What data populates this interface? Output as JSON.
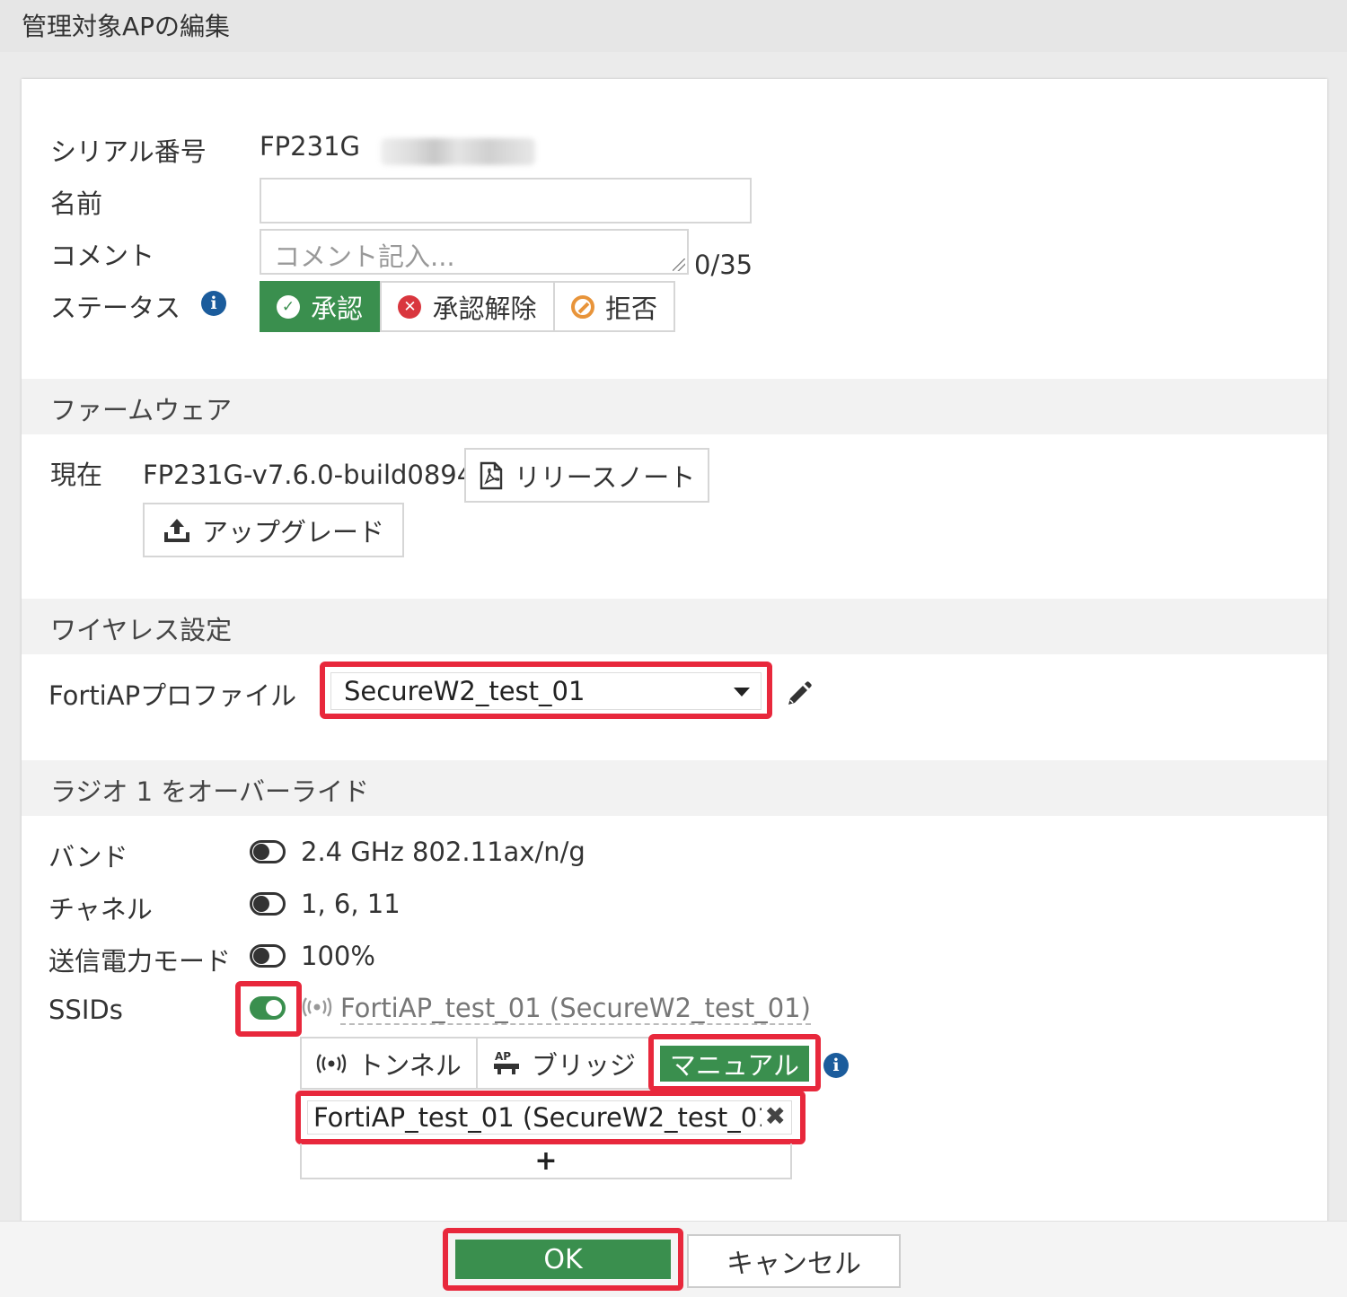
{
  "window": {
    "title": "管理対象APの編集"
  },
  "general": {
    "serial_label": "シリアル番号",
    "serial_value": "FP231G",
    "name_label": "名前",
    "name_value": "",
    "comment_label": "コメント",
    "comment_placeholder": "コメント記入...",
    "comment_counter": "0/35",
    "status_label": "ステータス",
    "status_options": [
      "承認",
      "承認解除",
      "拒否"
    ],
    "status_selected": "承認"
  },
  "firmware": {
    "section_title": "ファームウェア",
    "current_label": "現在",
    "current_value": "FP231G-v7.6.0-build0894",
    "release_notes_label": "リリースノート",
    "upgrade_label": "アップグレード"
  },
  "wireless": {
    "section_title": "ワイヤレス設定",
    "profile_label": "FortiAPプロファイル",
    "profile_value": "SecureW2_test_01"
  },
  "radio1": {
    "section_title": "ラジオ 1 をオーバーライド",
    "band_label": "バンド",
    "band_value": "2.4 GHz 802.11ax/n/g",
    "band_override": false,
    "channel_label": "チャネル",
    "channel_value": "1, 6, 11",
    "channel_override": false,
    "tx_power_label": "送信電力モード",
    "tx_power_value": "100%",
    "tx_power_override": false,
    "ssids_label": "SSIDs",
    "ssids_override": true,
    "ssid_inherited": "FortiAP_test_01 (SecureW2_test_01)",
    "ssid_modes": [
      "トンネル",
      "ブリッジ",
      "マニュアル"
    ],
    "ssid_mode_selected": "マニュアル",
    "ssid_entry": "FortiAP_test_01 (SecureW2_test_01",
    "add_label": "+"
  },
  "footer": {
    "ok_label": "OK",
    "cancel_label": "キャンセル"
  },
  "colors": {
    "accent_green": "#3a8f4e",
    "highlight_red": "#e8283c",
    "info_blue": "#1b5c9c"
  }
}
